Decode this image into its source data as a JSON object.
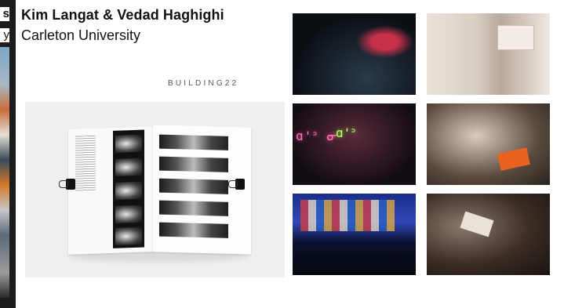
{
  "left_strip": {
    "line1": "s",
    "line2": "y"
  },
  "header": {
    "title": "Kim Langat & Vedad Haghighi",
    "subtitle": "Carleton University",
    "tag": "BUILDING22"
  },
  "feature_photo": {
    "page_heading": ""
  },
  "photos": [
    {
      "id": "photo-1"
    },
    {
      "id": "photo-2"
    },
    {
      "id": "photo-3",
      "neon_text_a": "ɑ'ᐣ ᓂ",
      "neon_text_b": "ɑ'ᐣ"
    },
    {
      "id": "photo-4"
    },
    {
      "id": "photo-5"
    },
    {
      "id": "photo-6"
    }
  ]
}
